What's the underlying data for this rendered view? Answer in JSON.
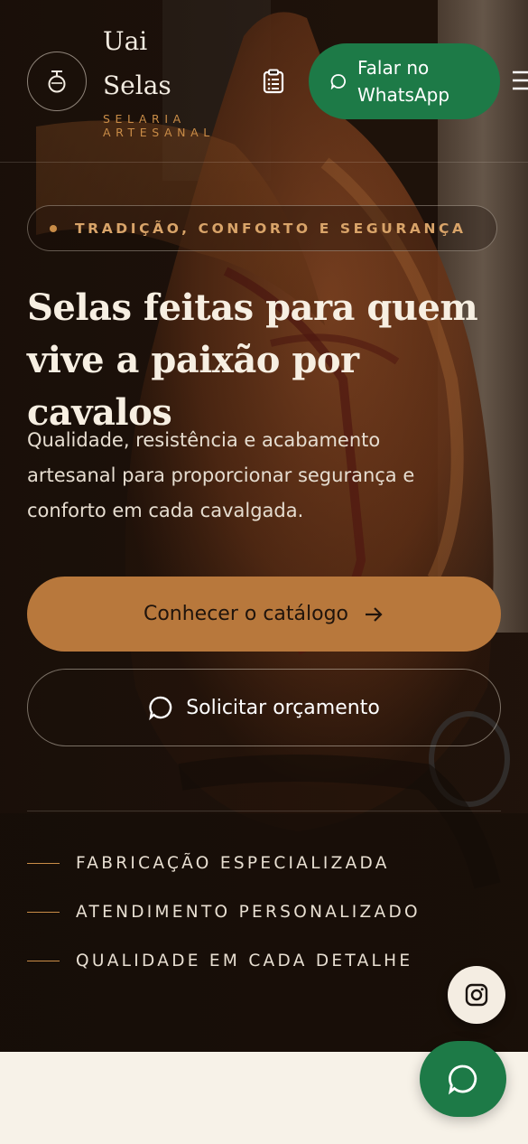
{
  "header": {
    "brand_line1": "Uai",
    "brand_line2": "Selas",
    "tagline_line1": "SELARIA",
    "tagline_line2": "ARTESANAL",
    "whatsapp_line1": "Falar no",
    "whatsapp_line2": "WhatsApp"
  },
  "hero": {
    "badge": "TRADIÇÃO, CONFORTO E SEGURANÇA",
    "headline_line1": "Selas feitas para quem",
    "headline_line2": "vive a paixão por cavalos",
    "subtext_line1": "Qualidade, resistência e acabamento",
    "subtext_line2": "artesanal para proporcionar segurança e",
    "subtext_line3": "conforto em cada cavalgada.",
    "cta_primary": "Conhecer o catálogo",
    "cta_secondary": "Solicitar orçamento"
  },
  "features": [
    "FABRICAÇÃO ESPECIALIZADA",
    "ATENDIMENTO PERSONALIZADO",
    "QUALIDADE EM CADA DETALHE"
  ],
  "colors": {
    "accent": "#b8783c",
    "accent_text": "#c98c47",
    "whatsapp_green": "#1d7a47",
    "page_background": "#f7f2e8"
  },
  "icons": {
    "logo": "saddle-pommel-icon",
    "catalog": "clipboard-icon",
    "menu": "hamburger-menu-icon",
    "primary_cta": "arrow-right-icon",
    "secondary_cta": "chat-bubble-icon",
    "instagram": "instagram-icon",
    "fab": "chat-bubble-icon"
  }
}
